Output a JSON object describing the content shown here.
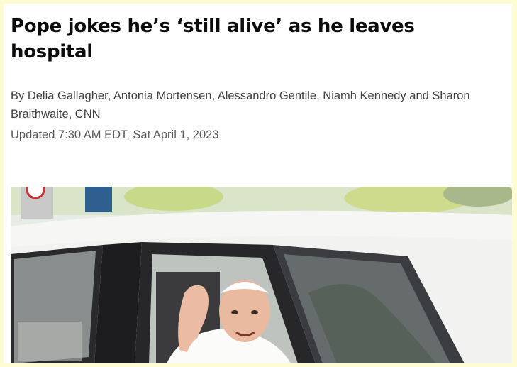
{
  "article": {
    "headline": "Pope jokes he’s ‘still alive’ as he leaves hospital",
    "byline": {
      "prefix": "By Delia Gallagher, ",
      "linked_author": "Antonia Mortensen",
      "rest": ", Alessandro Gentile, Niamh Kennedy and Sharon Braithwaite, CNN"
    },
    "timestamp": "Updated 7:30 AM EDT, Sat April 1, 2023"
  },
  "image": {
    "subject": "pope-waving-from-car-photo"
  },
  "colors": {
    "page_border": "#fdfcd2",
    "headline": "#0c0c0c",
    "byline": "#404040",
    "timestamp": "#595959"
  }
}
